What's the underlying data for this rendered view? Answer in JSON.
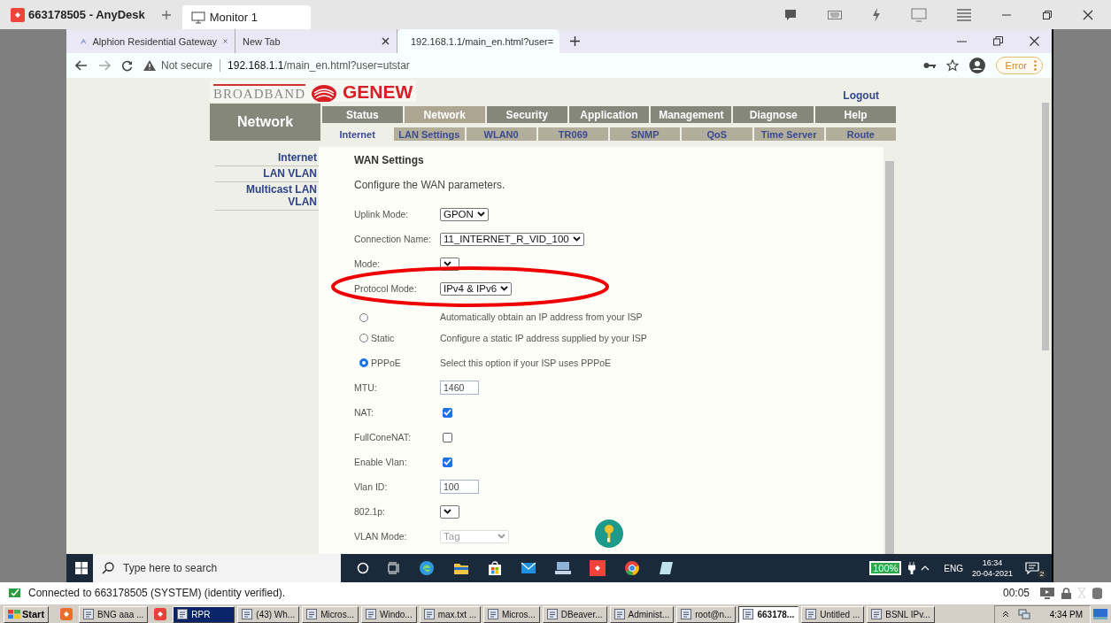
{
  "anydesk": {
    "session_title": "663178505 - AnyDesk",
    "tabs": [
      {
        "label": "Monitor 1",
        "selected": true
      }
    ]
  },
  "browser": {
    "tabs": [
      {
        "title": "Alphion Residential Gateway",
        "selected": false
      },
      {
        "title": "New Tab",
        "selected": false
      },
      {
        "title": "192.168.1.1/main_en.html?user=",
        "selected": true
      }
    ],
    "security_label": "Not secure",
    "url_host": "192.168.1.1",
    "url_path": "/main_en.html?user=utstar",
    "error_label": "Error"
  },
  "router_page": {
    "logo_sub": "BROADBAND",
    "logo_brand": "GENEW",
    "logout": "Logout",
    "section_title": "Network",
    "main_tabs": [
      {
        "label": "Status",
        "selected": false
      },
      {
        "label": "Network",
        "selected": true
      },
      {
        "label": "Security",
        "selected": false
      },
      {
        "label": "Application",
        "selected": false
      },
      {
        "label": "Management",
        "selected": false
      },
      {
        "label": "Diagnose",
        "selected": false
      },
      {
        "label": "Help",
        "selected": false
      }
    ],
    "sub_tabs": [
      {
        "label": "Internet",
        "selected": true
      },
      {
        "label": "LAN Settings",
        "selected": false
      },
      {
        "label": "WLAN0",
        "selected": false
      },
      {
        "label": "TR069",
        "selected": false
      },
      {
        "label": "SNMP",
        "selected": false
      },
      {
        "label": "QoS",
        "selected": false
      },
      {
        "label": "Time Server",
        "selected": false
      },
      {
        "label": "Route",
        "selected": false
      }
    ],
    "sidebar": [
      "Internet",
      "LAN VLAN",
      "Multicast LAN VLAN"
    ],
    "panel_title": "WAN Settings",
    "intro": "Configure the WAN parameters.",
    "fields": [
      {
        "kind": "select",
        "label": "Uplink Mode:",
        "value": "GPON"
      },
      {
        "kind": "select",
        "label": "Connection Name:",
        "value": "11_INTERNET_R_VID_100"
      },
      {
        "kind": "select",
        "label": "Mode:"
      },
      {
        "kind": "select",
        "label": "Protocol Mode:",
        "value": "IPv4 & IPv6"
      },
      {
        "kind": "radio",
        "selected": false,
        "description": "Automatically obtain an IP address from your ISP"
      },
      {
        "kind": "radio",
        "label": "Static",
        "selected": false,
        "description": "Configure a static IP address supplied by your ISP"
      },
      {
        "kind": "radio",
        "label": "PPPoE",
        "selected": true,
        "description": "Select this option if your ISP uses PPPoE"
      },
      {
        "kind": "input",
        "label": "MTU:",
        "value": "1460"
      },
      {
        "kind": "checkbox",
        "label": "NAT:",
        "checked": true
      },
      {
        "kind": "checkbox",
        "label": "FullConeNAT:",
        "checked": false
      },
      {
        "kind": "checkbox",
        "label": "Enable Vlan:",
        "checked": true
      },
      {
        "kind": "input",
        "label": "Vlan ID:",
        "value": "100"
      },
      {
        "kind": "select",
        "label": "802.1p:"
      },
      {
        "kind": "select",
        "label": "VLAN Mode:",
        "value": "Tag",
        "disabled": true
      }
    ]
  },
  "remote_taskbar": {
    "search_placeholder": "Type here to search",
    "battery": "100%",
    "language": "ENG",
    "time": "16:34",
    "date": "20-04-2021",
    "notification_count": "2"
  },
  "status": {
    "message": "Connected to 663178505 (SYSTEM) (identity verified).",
    "timer": "00:05"
  },
  "local_taskbar": {
    "start": "Start",
    "items": [
      {
        "kind": "icon"
      },
      {
        "kind": "app",
        "label": "BNG aaa ...",
        "selected": false
      },
      {
        "kind": "icon"
      },
      {
        "kind": "app",
        "label": "RPR",
        "selected": true
      },
      {
        "kind": "app",
        "label": "(43) Wh...",
        "selected": false
      },
      {
        "kind": "app",
        "label": "Micros...",
        "selected": false
      },
      {
        "kind": "app",
        "label": "Windo...",
        "selected": false
      },
      {
        "kind": "app",
        "label": "max.txt ...",
        "selected": false
      },
      {
        "kind": "app",
        "label": "Micros...",
        "selected": false
      },
      {
        "kind": "app",
        "label": "DBeaver...",
        "selected": false
      },
      {
        "kind": "app",
        "label": "Administ...",
        "selected": false
      },
      {
        "kind": "app",
        "label": "root@n...",
        "selected": false
      },
      {
        "kind": "app",
        "label": "663178...",
        "selected": true
      },
      {
        "kind": "app",
        "label": "Untitled ...",
        "selected": false
      },
      {
        "kind": "app",
        "label": "BSNL IPv...",
        "selected": false
      }
    ],
    "clock": "4:34 PM"
  }
}
